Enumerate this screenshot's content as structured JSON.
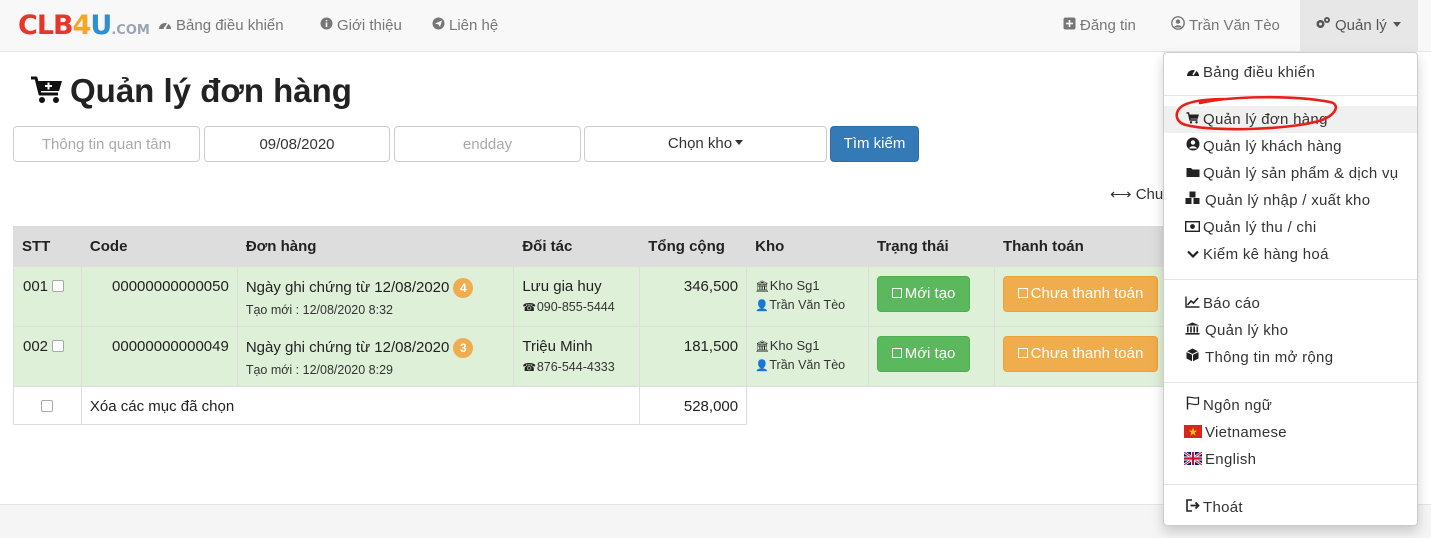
{
  "brand": {
    "part1": "CLB",
    "part2": "4",
    "part3": "U",
    "suffix": ".COM"
  },
  "nav": {
    "dashboard": "Bảng điều khiển",
    "about": "Giới thiệu",
    "contact": "Liên hệ",
    "post": "Đăng tin",
    "user": "Trần Văn Tèo",
    "manage": "Quản lý"
  },
  "page": {
    "title": "Quản lý đơn hàng"
  },
  "search": {
    "interest_placeholder": "Thông tin quan tâm",
    "start_date": "09/08/2020",
    "end_placeholder": "endday",
    "warehouse_label": "Chọn kho",
    "search_button": "Tìm kiếm"
  },
  "convert_label": "Chuy",
  "table": {
    "headers": [
      "STT",
      "Code",
      "Đơn hàng",
      "Đối tác",
      "Tổng cộng",
      "Kho",
      "Trạng thái",
      "Thanh toán"
    ],
    "rows": [
      {
        "stt": "001",
        "code": "00000000000050",
        "order_title": "Ngày ghi chứng từ 12/08/2020",
        "badge": "4",
        "created": "Tạo mới : 12/08/2020 8:32",
        "partner": "Lưu gia huy",
        "phone": "090-855-5444",
        "total": "346,500",
        "warehouse": "Kho Sg1",
        "staff": "Trần Văn Tèo",
        "status": "Mới tạo",
        "payment": "Chưa thanh toán"
      },
      {
        "stt": "002",
        "code": "00000000000049",
        "order_title": "Ngày ghi chứng từ 12/08/2020",
        "badge": "3",
        "created": "Tạo mới : 12/08/2020 8:29",
        "partner": "Triệu Minh",
        "phone": "876-544-4333",
        "total": "181,500",
        "warehouse": "Kho Sg1",
        "staff": "Trần Văn Tèo",
        "status": "Mới tạo",
        "payment": "Chưa thanh toán"
      }
    ],
    "footer": {
      "delete_label": "Xóa các mục đã chọn",
      "grand_total": "528,000"
    }
  },
  "dropdown": {
    "dashboard": "Bảng điều khiển",
    "orders": "Quản lý đơn hàng",
    "customers": "Quản lý khách hàng",
    "products": "Quản lý sản phẩm & dịch vụ",
    "import_export": "Quản lý nhập / xuất kho",
    "income": "Quản lý thu / chi",
    "inventory": "Kiểm kê hàng hoá",
    "report": "Báo cáo",
    "warehouses": "Quản lý kho",
    "extended": "Thông tin mở rộng",
    "language": "Ngôn ngữ",
    "vietnamese": "Vietnamese",
    "english": "English",
    "logout": "Thoát"
  },
  "colors": {
    "brand_red": "#e8352a",
    "brand_orange": "#f5a623",
    "brand_blue": "#2f8fd0",
    "primary": "#337ab7",
    "success": "#5cb85c",
    "warning": "#f0ad4e",
    "row_green": "#dff0d8",
    "annotation_red": "#e8201a"
  },
  "icons": {
    "nav_dashboard": "dashboard-icon",
    "nav_about": "info-icon",
    "nav_contact": "send-icon",
    "nav_post": "plus-square-icon",
    "nav_user": "user-circle-icon",
    "nav_manage": "gears-icon",
    "title": "cart-icon"
  }
}
